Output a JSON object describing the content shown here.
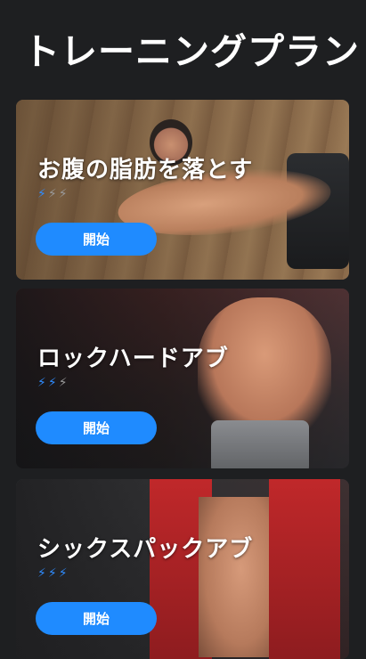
{
  "header": {
    "title": "トレーニングプラン"
  },
  "colors": {
    "accent": "#1f8bff",
    "background": "#1e1f21",
    "bolt_active": "#2f8cff",
    "bolt_inactive": "#9a9a9a"
  },
  "plans": [
    {
      "title": "お腹の脂肪を落とす",
      "difficulty": 1,
      "difficulty_max": 3,
      "button_label": "開始"
    },
    {
      "title": "ロックハードアブ",
      "difficulty": 2,
      "difficulty_max": 3,
      "button_label": "開始"
    },
    {
      "title": "シックスパックアブ",
      "difficulty": 3,
      "difficulty_max": 3,
      "button_label": "開始"
    }
  ],
  "icons": {
    "difficulty": "lightning-bolt-icon"
  }
}
